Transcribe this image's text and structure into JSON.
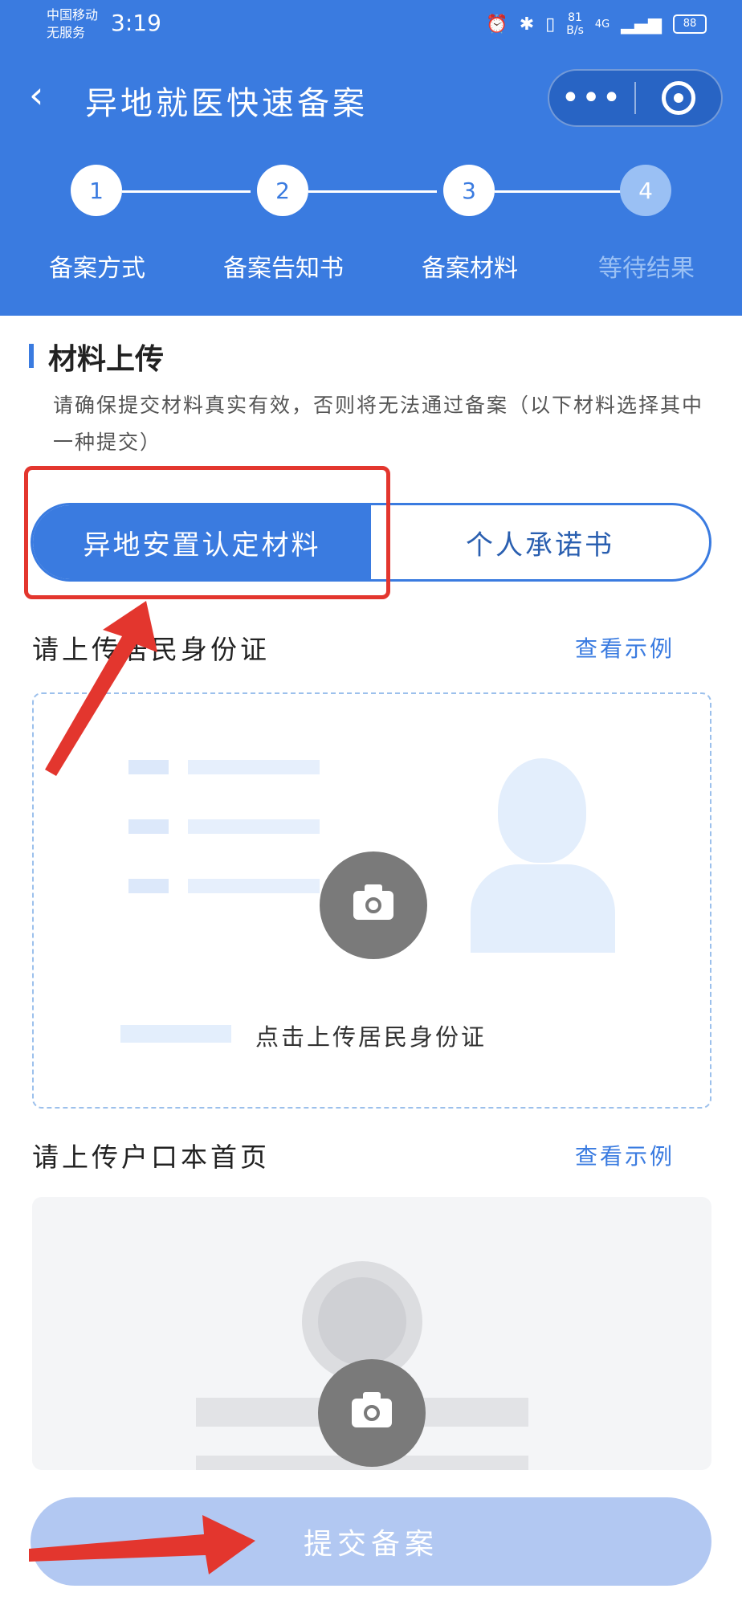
{
  "status_bar": {
    "carrier_line1": "中国移动",
    "carrier_line2": "无服务",
    "time": "3:19",
    "speed_value": "81",
    "speed_unit": "B/s",
    "network": "4G",
    "battery": "88"
  },
  "nav": {
    "back_glyph": "‹",
    "title": "异地就医快速备案",
    "more_glyph": "•••"
  },
  "steps": [
    {
      "number": "1",
      "label": "备案方式",
      "state": "done"
    },
    {
      "number": "2",
      "label": "备案告知书",
      "state": "done"
    },
    {
      "number": "3",
      "label": "备案材料",
      "state": "current"
    },
    {
      "number": "4",
      "label": "等待结果",
      "state": "pending"
    }
  ],
  "section": {
    "title": "材料上传",
    "notice": "请确保提交材料真实有效，否则将无法通过备案（以下材料选择其中一种提交）"
  },
  "material_tabs": {
    "active": "异地安置认定材料",
    "inactive": "个人承诺书"
  },
  "id_card_upload": {
    "title": "请上传居民身份证",
    "example_link": "查看示例",
    "tip": "点击上传居民身份证"
  },
  "household_upload": {
    "title": "请上传户口本首页",
    "example_link": "查看示例"
  },
  "submit_button": "提交备案",
  "colors": {
    "primary": "#3a7be0",
    "annotation_red": "#e3362e",
    "submit_disabled": "#b2c8f2"
  }
}
